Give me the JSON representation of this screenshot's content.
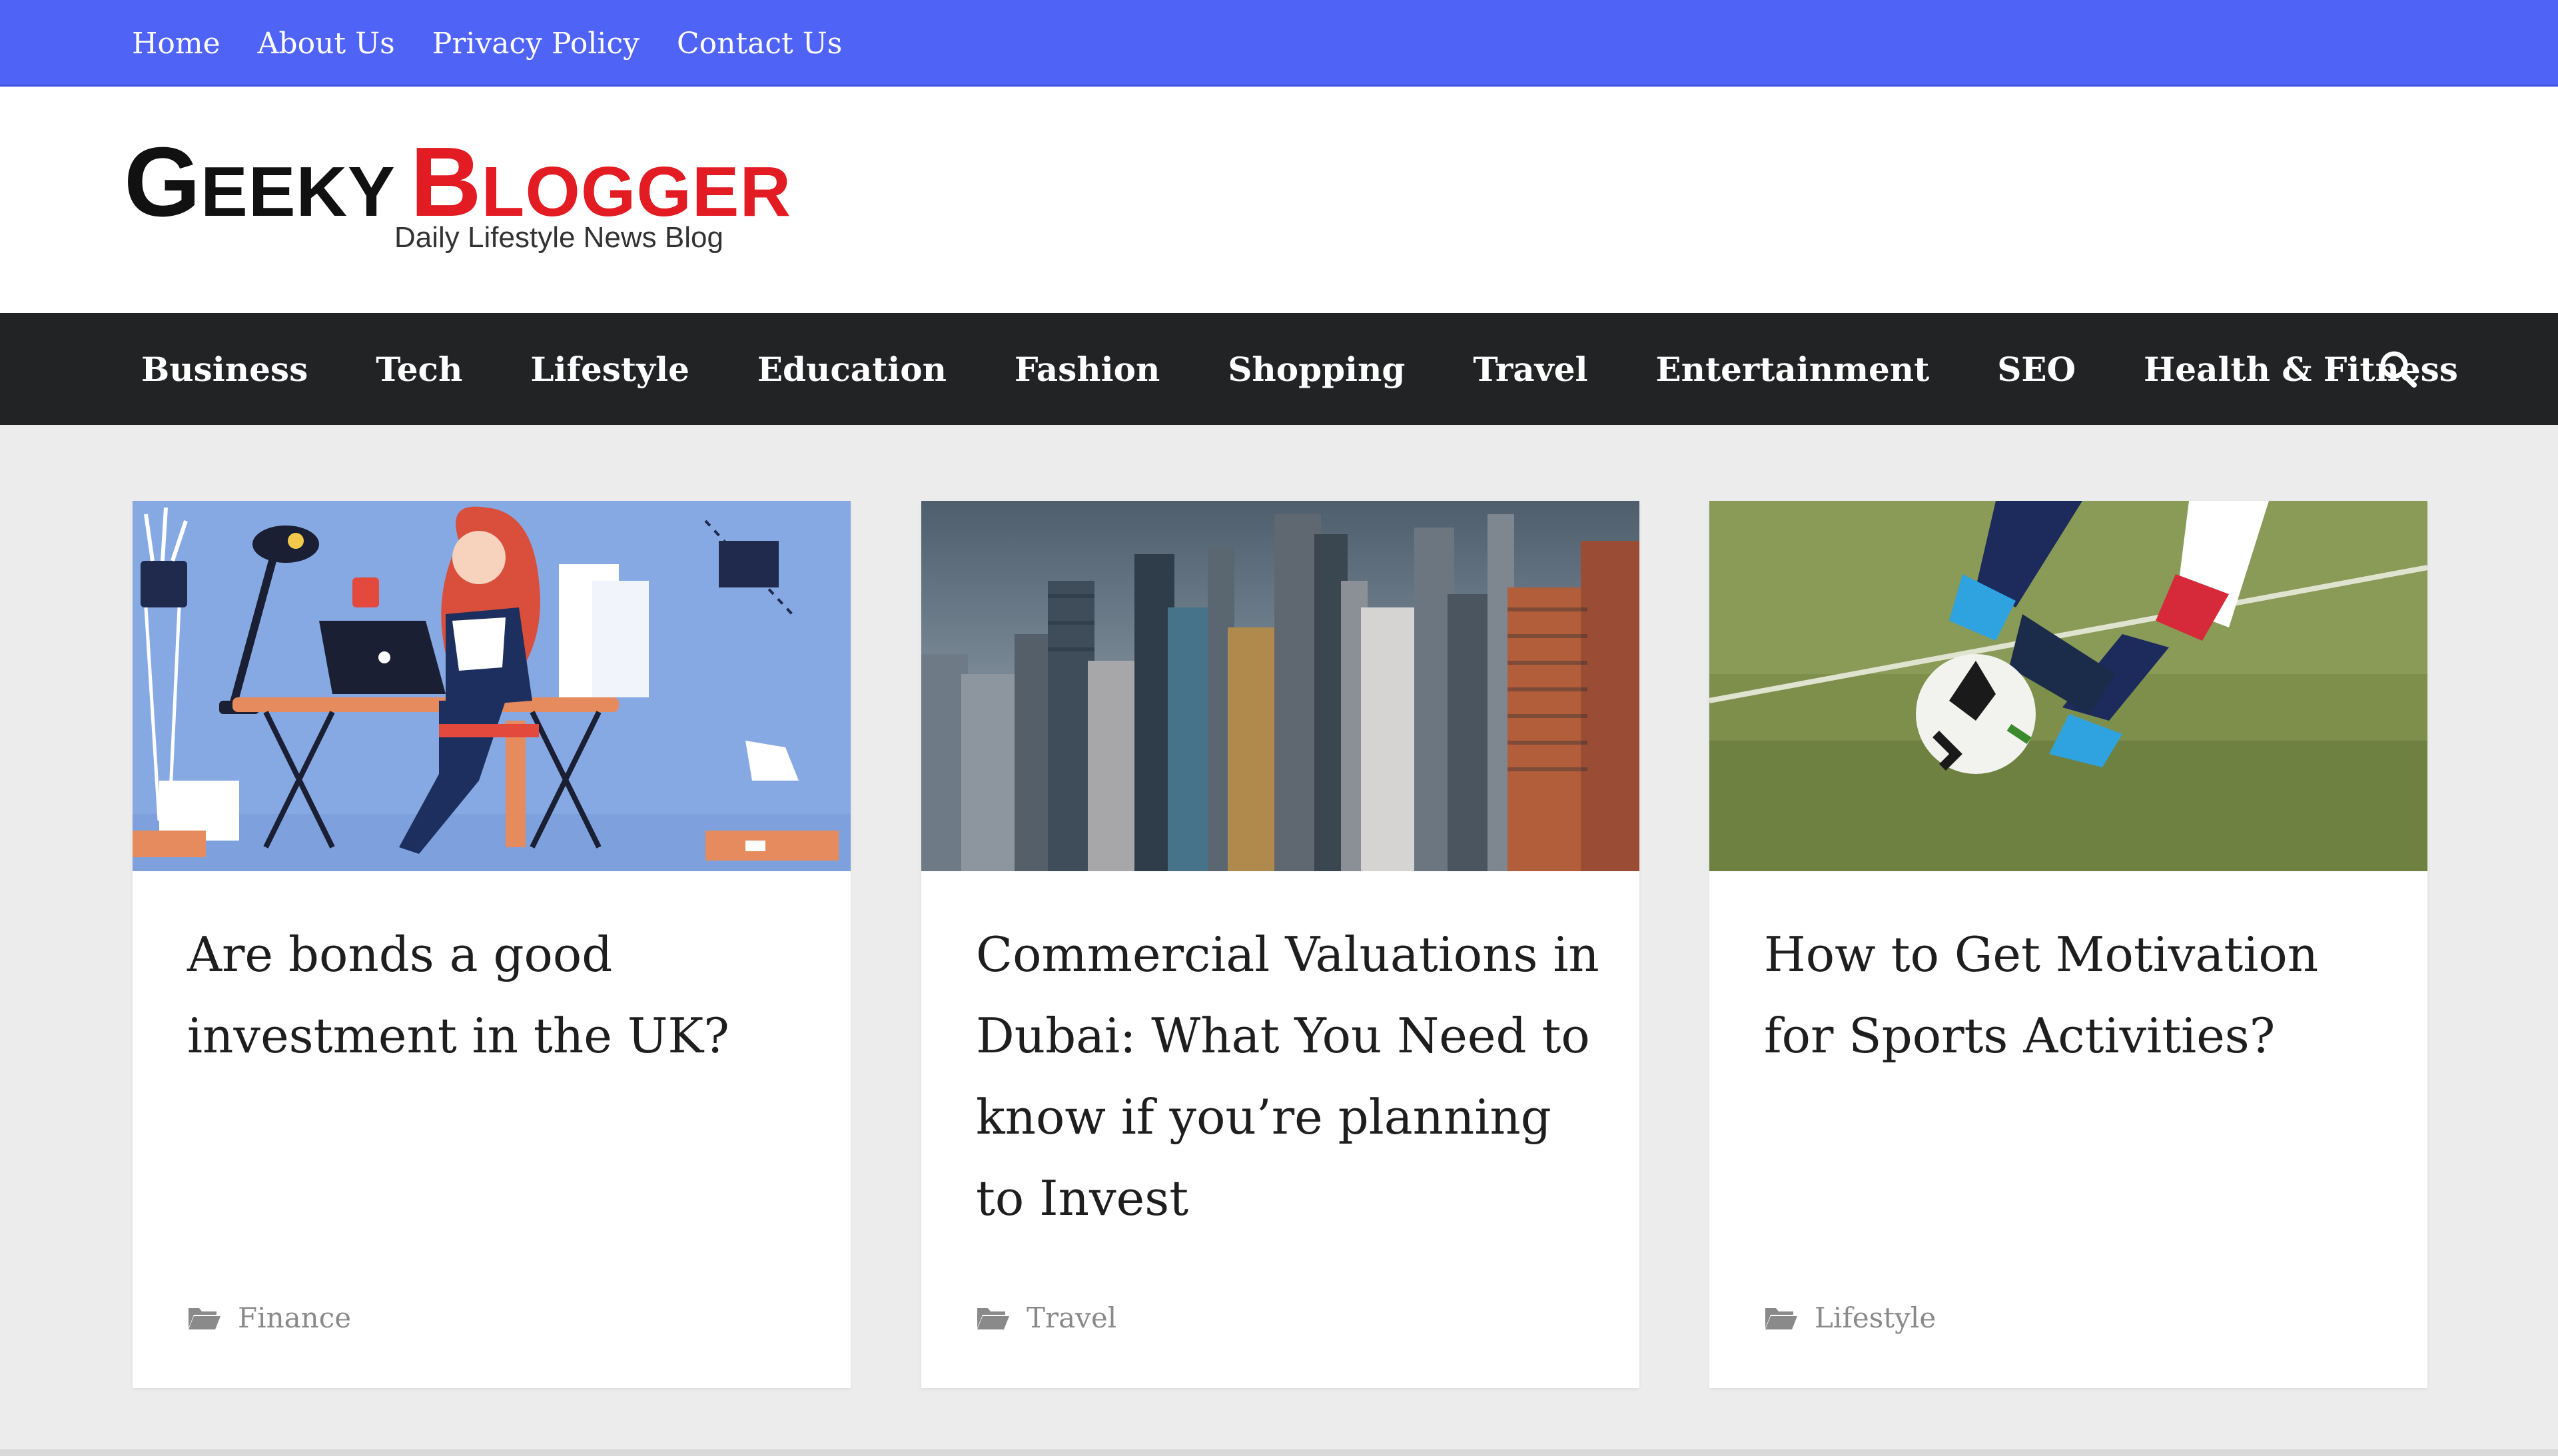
{
  "topbar": {
    "links": [
      "Home",
      "About Us",
      "Privacy Policy",
      "Contact Us"
    ]
  },
  "logo": {
    "word1_initial": "G",
    "word1_rest": "EEKY",
    "word2_initial": "B",
    "word2_rest": "LOGGER",
    "tagline": "Daily Lifestyle News Blog"
  },
  "nav": {
    "items": [
      "Business",
      "Tech",
      "Lifestyle",
      "Education",
      "Fashion",
      "Shopping",
      "Travel",
      "Entertainment",
      "SEO",
      "Health & Fitness"
    ],
    "search_icon": "search-icon"
  },
  "colors": {
    "topbar": "#4f63f7",
    "nav": "#222325",
    "logo_red": "#e31b23",
    "page_bg": "#ececec"
  },
  "posts": [
    {
      "title": "Are bonds a good investment in the UK?",
      "category": "Finance",
      "image": "office-desk-illustration"
    },
    {
      "title": "Commercial Valuations in Dubai: What You Need to know if you’re planning to Invest",
      "category": "Travel",
      "image": "city-skyline-photo"
    },
    {
      "title": "How to Get Motivation for Sports Activities?",
      "category": "Lifestyle",
      "image": "soccer-kick-photo"
    }
  ]
}
